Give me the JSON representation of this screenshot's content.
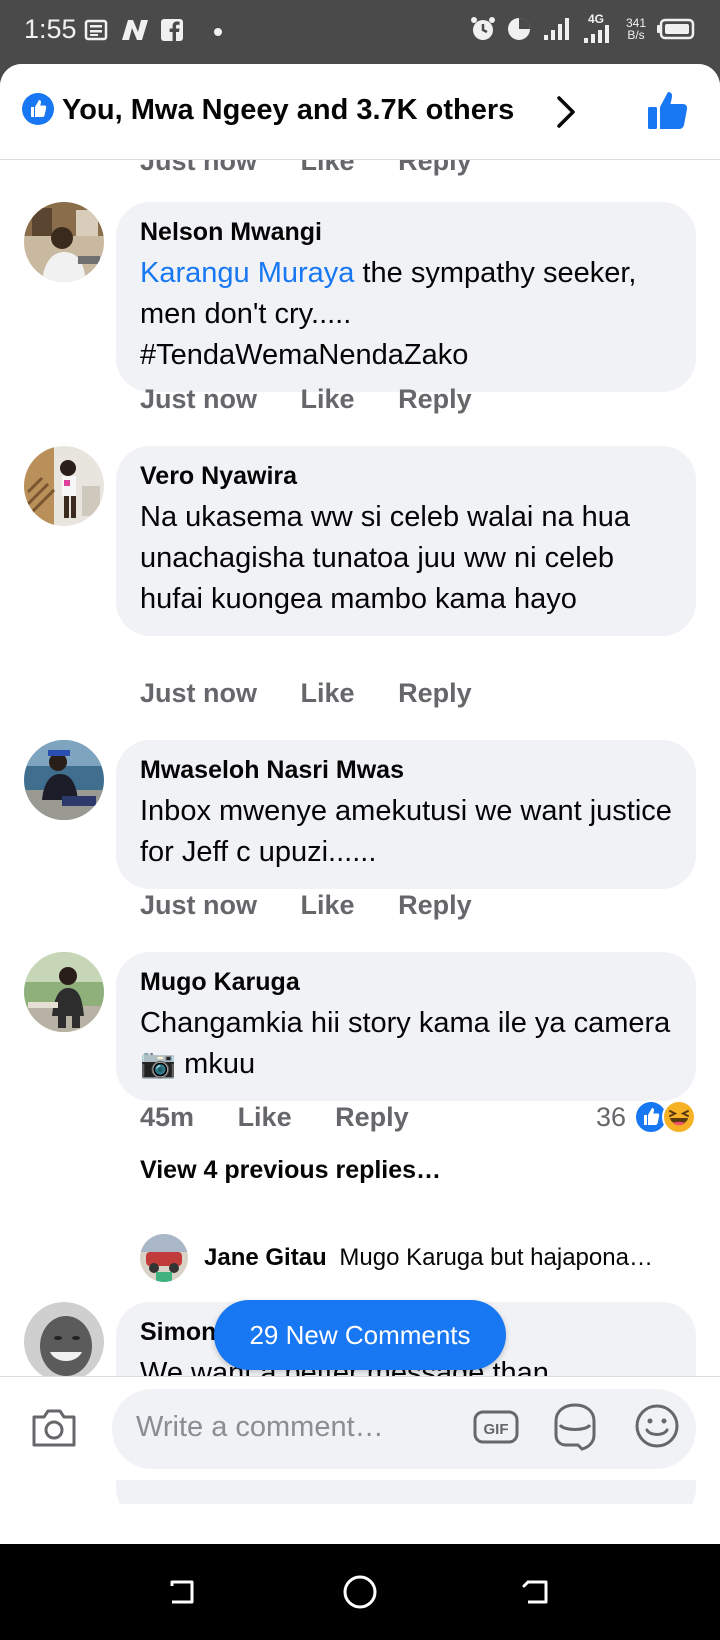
{
  "status_bar": {
    "time": "1:55",
    "network_gen": "4G",
    "network_speed_value": "341",
    "network_speed_unit": "B/s"
  },
  "reactions_header": {
    "summary": "You, Mwa Ngeey and 3.7K others"
  },
  "clipped_meta": {
    "time": "Just now",
    "like": "Like",
    "reply": "Reply"
  },
  "comments": [
    {
      "author": "Nelson Mwangi",
      "mention": "Karangu Muraya",
      "text": " the sympathy seeker, men don't cry.....",
      "text2": "#TendaWemaNendaZako",
      "time": "Just now",
      "like": "Like",
      "reply": "Reply"
    },
    {
      "author": "Vero Nyawira",
      "text": "Na ukasema ww si celeb walai na hua unachagisha tunatoa juu ww ni celeb hufai kuongea mambo kama hayo",
      "time": "Just now",
      "like": "Like",
      "reply": "Reply"
    },
    {
      "author": "Mwaseloh Nasri Mwas",
      "text": "Inbox mwenye amekutusi we want justice for Jeff c upuzi......",
      "time": "Just now",
      "like": "Like",
      "reply": "Reply"
    },
    {
      "author": "Mugo Karuga",
      "text": "Changamkia hii story kama ile ya camera 📷 mkuu",
      "time": "45m",
      "like": "Like",
      "reply": "Reply",
      "reaction_count": "36",
      "view_previous": "View 4 previous replies…",
      "reply_preview": {
        "author": "Jane Gitau",
        "text": "Mugo Karuga but hajapona…"
      }
    },
    {
      "author": "Simon Kijana WA Baba",
      "text": "We want a better message than this."
    }
  ],
  "new_comments_button": "29 New Comments",
  "composer": {
    "placeholder": "Write a comment…",
    "gif_label": "GIF"
  },
  "colors": {
    "accent": "#1877f2",
    "bubble": "#f0f2f5",
    "meta": "#65676b"
  }
}
